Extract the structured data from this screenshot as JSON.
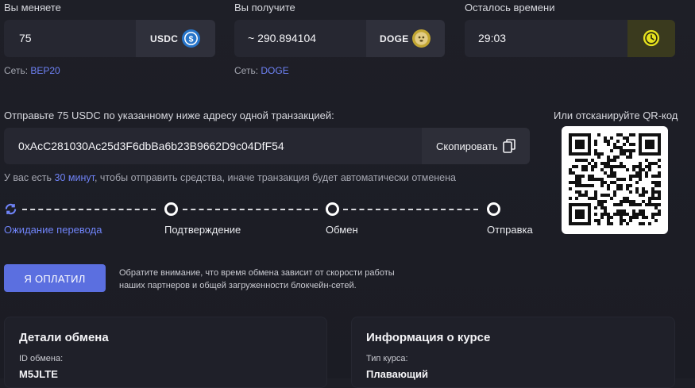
{
  "exchange": {
    "give": {
      "label": "Вы меняете",
      "value": "75",
      "coin": "USDC",
      "network_label": "Сеть:",
      "network": "BEP20",
      "icon": "usdc-icon",
      "color": "#2775ca"
    },
    "get": {
      "label": "Вы получите",
      "value": "~ 290.894104",
      "coin": "DOGE",
      "network_label": "Сеть:",
      "network": "DOGE",
      "icon": "doge-icon",
      "color": "#c2a633"
    },
    "time": {
      "label": "Осталось времени",
      "value": "29:03",
      "icon": "clock-icon",
      "color": "#e6e21e"
    }
  },
  "address": {
    "instruction": "Отправьте 75 USDC по указанному ниже адресу одной транзакцией:",
    "value": "0xAcC281030Ac25d3F6dbBa6b23B9662D9c04DfF54",
    "copy_label": "Скопировать",
    "qr_label": "Или отсканируйте QR-код"
  },
  "notice": {
    "prefix": "У вас есть",
    "link": "30 минут",
    "suffix": ", чтобы отправить средства, иначе транзакция будет автоматически отменена"
  },
  "steps": [
    {
      "label": "Ожидание перевода",
      "state": "active"
    },
    {
      "label": "Подтверждение",
      "state": "pending"
    },
    {
      "label": "Обмен",
      "state": "pending"
    },
    {
      "label": "Отправка",
      "state": "pending"
    }
  ],
  "paid_button": "Я ОПЛАТИЛ",
  "paid_note_line1": "Обратите внимание, что время обмена зависит от скорости работы",
  "paid_note_line2": "наших партнеров и общей загруженности блокчейн-сетей.",
  "details": {
    "title": "Детали обмена",
    "id_label": "ID обмена:",
    "id_value": "M5JLTE"
  },
  "rate": {
    "title": "Информация о курсе",
    "type_label": "Тип курса:",
    "type_value": "Плавающий"
  },
  "colors": {
    "accent": "#6f83f7",
    "button": "#5b6fe0"
  }
}
